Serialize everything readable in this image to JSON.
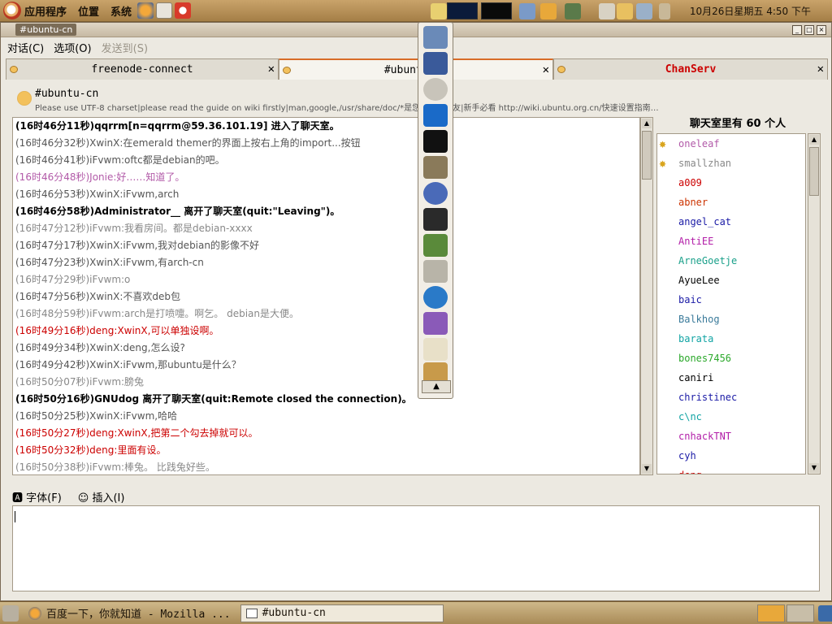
{
  "topbar": {
    "menus": [
      "应用程序",
      "位置",
      "系统"
    ],
    "clock": "10月26日星期五  4:50 下午"
  },
  "window": {
    "title": "#ubuntu-cn",
    "menus": [
      "对话(C)",
      "选项(O)",
      "发送到(S)"
    ],
    "tabs": [
      {
        "label": "freenode-connect"
      },
      {
        "label": "#ubuntu-cn"
      },
      {
        "label": "ChanServ"
      }
    ]
  },
  "topic": {
    "channel": "#ubuntu-cn",
    "text": "Please use UTF-8 charset|please read the guide on wiki firstly|man,google,/usr/share/doc/*是您的良师益友|新手必看 http://wiki.ubuntu.org.cn/快速设置指南…"
  },
  "chat": [
    {
      "text": "(16时46分11秒)qqrrm[n=qqrrm@59.36.101.19] 进入了聊天室。",
      "color": "#000000",
      "bold": true
    },
    {
      "text": "(16时46分32秒)XwinX:在emerald themer的界面上按右上角的import...按钮",
      "color": "#555555",
      "bold": false
    },
    {
      "text": "(16时46分41秒)iFvwm:oftc都是debian的吧。",
      "color": "#555555",
      "bold": false
    },
    {
      "text": "(16时46分48秒)Jonie:好……知道了。",
      "color": "#b25aa8",
      "bold": false
    },
    {
      "text": "(16时46分53秒)XwinX:iFvwm,arch",
      "color": "#555555",
      "bold": false
    },
    {
      "text": "(16时46分58秒)Administrator__ 离开了聊天室(quit:\"Leaving\")。",
      "color": "#000000",
      "bold": true
    },
    {
      "text": "(16时47分12秒)iFvwm:我看房间。都是debian-xxxx",
      "color": "#888888",
      "bold": false
    },
    {
      "text": "(16时47分17秒)XwinX:iFvwm,我对debian的影像不好",
      "color": "#555555",
      "bold": false
    },
    {
      "text": "(16时47分23秒)XwinX:iFvwm,有arch-cn",
      "color": "#555555",
      "bold": false
    },
    {
      "text": "(16时47分29秒)iFvwm:o",
      "color": "#888888",
      "bold": false
    },
    {
      "text": "(16时47分56秒)XwinX:不喜欢deb包",
      "color": "#555555",
      "bold": false
    },
    {
      "text": "(16时48分59秒)iFvwm:arch是打喷嚏。啊乞。 debian是大便。",
      "color": "#888888",
      "bold": false
    },
    {
      "text": "(16时49分16秒)deng:XwinX,可以单独设啊。",
      "color": "#cc0000",
      "bold": false
    },
    {
      "text": "(16时49分34秒)XwinX:deng,怎么设?",
      "color": "#555555",
      "bold": false
    },
    {
      "text": "(16时49分42秒)XwinX:iFvwm,那ubuntu是什么？",
      "color": "#555555",
      "bold": false
    },
    {
      "text": "(16时50分07秒)iFvwm:膀兔",
      "color": "#888888",
      "bold": false
    },
    {
      "text": "(16时50分16秒)GNUdog 离开了聊天室(quit:Remote closed the connection)。",
      "color": "#000000",
      "bold": true
    },
    {
      "text": "(16时50分25秒)XwinX:iFvwm,哈哈",
      "color": "#555555",
      "bold": false
    },
    {
      "text": "(16时50分27秒)deng:XwinX,把第二个勾去掉就可以。",
      "color": "#cc0000",
      "bold": false
    },
    {
      "text": "(16时50分32秒)deng:里面有设。",
      "color": "#cc0000",
      "bold": false
    },
    {
      "text": "(16时50分38秒)iFvwm:棒兔。 比践兔好些。",
      "color": "#888888",
      "bold": false
    }
  ],
  "users": {
    "header": "聊天室里有 60 个人",
    "list": [
      {
        "name": "oneleaf",
        "color": "#b25aa8",
        "op": true
      },
      {
        "name": "smallzhan",
        "color": "#888888",
        "op": true
      },
      {
        "name": "a009",
        "color": "#cc0000",
        "op": false
      },
      {
        "name": "abner",
        "color": "#cc3300",
        "op": false
      },
      {
        "name": "angel_cat",
        "color": "#1a1aa6",
        "op": false
      },
      {
        "name": "AntiEE",
        "color": "#b21ea8",
        "op": false
      },
      {
        "name": "ArneGoetje",
        "color": "#1aa08a",
        "op": false
      },
      {
        "name": "AyueLee",
        "color": "#000000",
        "op": false
      },
      {
        "name": "baic",
        "color": "#1a1aa6",
        "op": false
      },
      {
        "name": "Balkhog",
        "color": "#3a7a9a",
        "op": false
      },
      {
        "name": "barata",
        "color": "#11a4a4",
        "op": false
      },
      {
        "name": "bones7456",
        "color": "#2aa82a",
        "op": false
      },
      {
        "name": "caniri",
        "color": "#000000",
        "op": false
      },
      {
        "name": "christinec",
        "color": "#1a1aa6",
        "op": false
      },
      {
        "name": "c\\nc",
        "color": "#11a4a4",
        "op": false
      },
      {
        "name": "cnhackTNT",
        "color": "#b21ea8",
        "op": false
      },
      {
        "name": "cyh",
        "color": "#1a1aa6",
        "op": false
      },
      {
        "name": "deng",
        "color": "#cc0000",
        "op": false
      }
    ]
  },
  "toolbar": {
    "font": "字体(F)",
    "insert": "插入(I)"
  },
  "taskbar": {
    "items": [
      "百度一下，你就知道 - Mozilla ...",
      "#ubuntu-cn"
    ]
  }
}
